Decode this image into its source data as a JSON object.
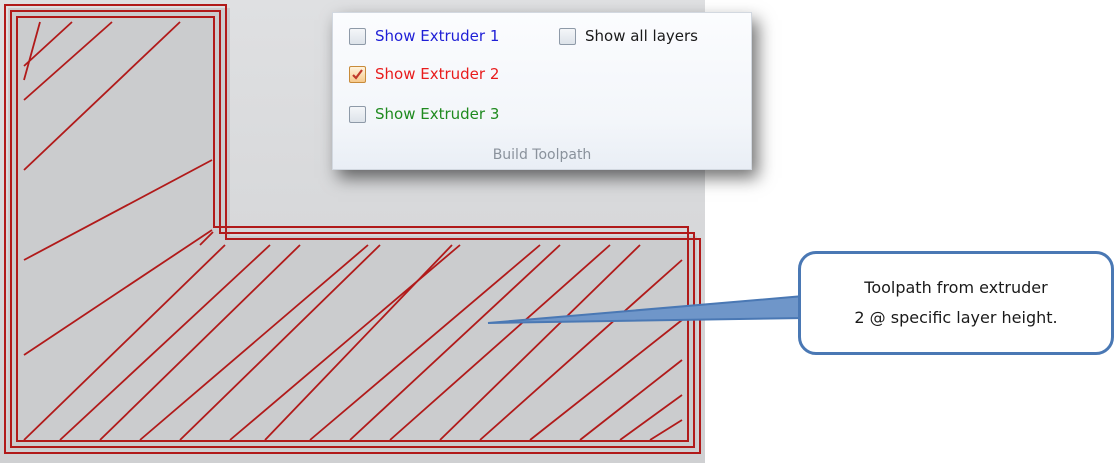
{
  "toolpath_panel": {
    "group_label": "Build Toolpath",
    "options": [
      {
        "label": "Show Extruder 1",
        "checked": false,
        "color": "#1f1fd6"
      },
      {
        "label": "Show all layers",
        "checked": false,
        "color": "#1a1a1a"
      },
      {
        "label": "Show Extruder 2",
        "checked": true,
        "color": "#e81c1c"
      },
      {
        "label": "Show Extruder 3",
        "checked": false,
        "color": "#1f8a1f"
      }
    ]
  },
  "callout": {
    "line1": "Toolpath from extruder",
    "line2": "2 @ specific layer height."
  },
  "colors": {
    "toolpath": "#b11a1a",
    "part_fill": "#cbccce",
    "background": "#d6d7d9",
    "callout_border": "#4a78b4"
  }
}
